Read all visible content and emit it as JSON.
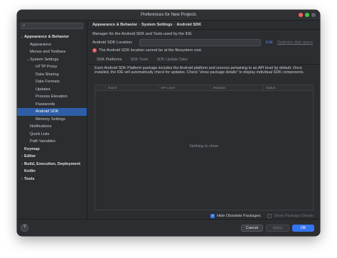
{
  "window": {
    "title": "Preferences for New Projects",
    "accent": "#3574f0"
  },
  "sidebar": {
    "search_icon": "search-icon",
    "items": [
      {
        "label": "Appearance & Behavior",
        "level": 0,
        "chevron": "⌄",
        "bold": true
      },
      {
        "label": "Appearance",
        "level": 1,
        "chevron": ""
      },
      {
        "label": "Menus and Toolbars",
        "level": 1,
        "chevron": ""
      },
      {
        "label": "System Settings",
        "level": 1,
        "chevron": "⌄"
      },
      {
        "label": "HTTP Proxy",
        "level": 2,
        "chevron": ""
      },
      {
        "label": "Data Sharing",
        "level": 2,
        "chevron": ""
      },
      {
        "label": "Date Formats",
        "level": 2,
        "chevron": ""
      },
      {
        "label": "Updates",
        "level": 2,
        "chevron": ""
      },
      {
        "label": "Process Elevation",
        "level": 2,
        "chevron": ""
      },
      {
        "label": "Passwords",
        "level": 2,
        "chevron": ""
      },
      {
        "label": "Android SDK",
        "level": 2,
        "chevron": "",
        "selected": true
      },
      {
        "label": "Memory Settings",
        "level": 2,
        "chevron": ""
      },
      {
        "label": "Notifications",
        "level": 1,
        "chevron": ""
      },
      {
        "label": "Quick Lists",
        "level": 1,
        "chevron": ""
      },
      {
        "label": "Path Variables",
        "level": 1,
        "chevron": ""
      },
      {
        "label": "Keymap",
        "level": 0,
        "chevron": "",
        "bold": true
      },
      {
        "label": "Editor",
        "level": 0,
        "chevron": "›",
        "bold": true
      },
      {
        "label": "Build, Execution, Deployment",
        "level": 0,
        "chevron": "›",
        "bold": true
      },
      {
        "label": "Kotlin",
        "level": 0,
        "chevron": "",
        "bold": true
      },
      {
        "label": "Tools",
        "level": 0,
        "chevron": "›",
        "bold": true
      }
    ]
  },
  "breadcrumb": [
    "Appearance & Behavior",
    "System Settings",
    "Android SDK"
  ],
  "main": {
    "description": "Manager for the Android SDK and Tools used by the IDE",
    "location_label": "Android SDK Location:",
    "location_value": "",
    "edit_label": "Edit",
    "optimize_label": "Optimize disk space",
    "error_text": "The Android SDK location cannot be at the filesystem root.",
    "tabs": [
      "SDK Platforms",
      "SDK Tools",
      "SDK Update Sites"
    ],
    "active_tab": 0,
    "panel_text": "Each Android SDK Platform package includes the Android platform and sources pertaining to an API level by default. Once installed, the IDE will automatically check for updates. Check \"show package details\" to display individual SDK components.",
    "table_headers": [
      "",
      "Name",
      "API Level",
      "Revision",
      "Status"
    ],
    "empty_text": "Nothing to show",
    "hide_obsolete_label": "Hide Obsolete Packages",
    "hide_obsolete_checked": true,
    "show_details_label": "Show Package Details",
    "show_details_checked": false
  },
  "footer": {
    "help_label": "?",
    "cancel_label": "Cancel",
    "apply_label": "Apply",
    "ok_label": "OK"
  }
}
